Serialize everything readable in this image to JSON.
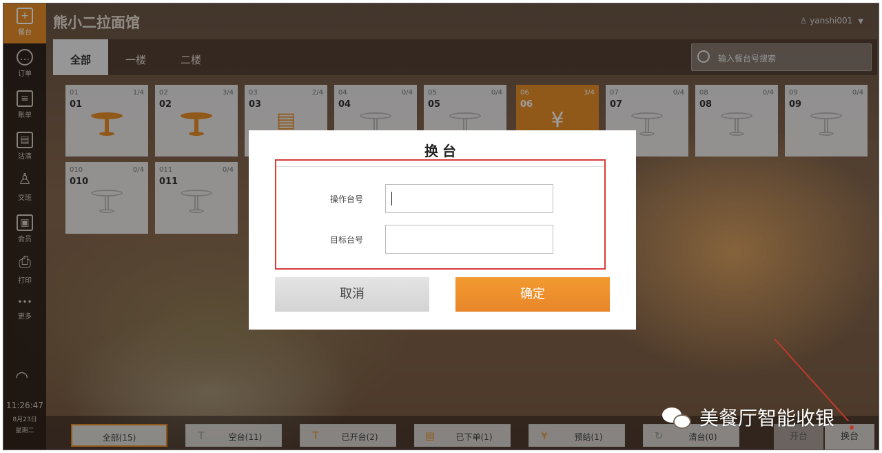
{
  "sidebar": {
    "items": [
      {
        "label": "餐台",
        "icon": "plus-icon",
        "glyph": "+"
      },
      {
        "label": "订单",
        "icon": "chat-icon",
        "glyph": "…"
      },
      {
        "label": "账单",
        "icon": "list-icon",
        "glyph": "≡"
      },
      {
        "label": "沽清",
        "icon": "document-icon",
        "glyph": "▤"
      },
      {
        "label": "交班",
        "icon": "person-icon",
        "glyph": "♙"
      },
      {
        "label": "会员",
        "icon": "id-card-icon",
        "glyph": "▣"
      },
      {
        "label": "打印",
        "icon": "printer-icon",
        "glyph": "⎙"
      },
      {
        "label": "更多",
        "icon": "more-dots-icon",
        "glyph": "•••"
      }
    ],
    "time": "11:26:47",
    "date": "8月23日",
    "weekday": "星期二"
  },
  "header": {
    "title": "熊小二拉面馆",
    "user": "yanshi001"
  },
  "tabs": [
    {
      "label": "全部",
      "active": true
    },
    {
      "label": "一楼",
      "active": false
    },
    {
      "label": "二楼",
      "active": false
    }
  ],
  "search": {
    "placeholder": "输入餐台号搜索"
  },
  "tables": [
    {
      "code": "01",
      "name": "01",
      "occupancy": "1/4",
      "state": "open"
    },
    {
      "code": "02",
      "name": "02",
      "occupancy": "3/4",
      "state": "open"
    },
    {
      "code": "03",
      "name": "03",
      "occupancy": "2/4",
      "state": "ordered"
    },
    {
      "code": "04",
      "name": "04",
      "occupancy": "0/4",
      "state": "empty"
    },
    {
      "code": "05",
      "name": "05",
      "occupancy": "0/4",
      "state": "empty"
    },
    {
      "code": "06",
      "name": "06",
      "occupancy": "3/4",
      "state": "prepaid"
    },
    {
      "code": "07",
      "name": "07",
      "occupancy": "0/4",
      "state": "empty"
    },
    {
      "code": "08",
      "name": "08",
      "occupancy": "0/4",
      "state": "empty"
    },
    {
      "code": "09",
      "name": "09",
      "occupancy": "0/4",
      "state": "empty"
    },
    {
      "code": "010",
      "name": "010",
      "occupancy": "0/4",
      "state": "empty"
    },
    {
      "code": "011",
      "name": "011",
      "occupancy": "0/4",
      "state": "empty"
    }
  ],
  "filters": [
    {
      "label": "全部(15)",
      "icon": "",
      "active": true
    },
    {
      "label": "空台(11)",
      "icon": "empty-table-icon",
      "active": false
    },
    {
      "label": "已开台(2)",
      "icon": "table-icon",
      "active": false
    },
    {
      "label": "已下单(1)",
      "icon": "order-list-icon",
      "active": false
    },
    {
      "label": "预结(1)",
      "icon": "yen-icon",
      "active": false
    },
    {
      "label": "清台(0)",
      "icon": "refresh-icon",
      "active": false
    }
  ],
  "actions": {
    "open_table": "开台",
    "change_table": "换台"
  },
  "modal": {
    "title": "换台",
    "source_label": "操作台号",
    "target_label": "目标台号",
    "source_value": "",
    "target_value": "",
    "cancel": "取消",
    "confirm": "确定"
  },
  "watermark": "美餐厅智能收银",
  "colors": {
    "accent": "#e8902a",
    "highlight_border": "#d63a3a"
  }
}
